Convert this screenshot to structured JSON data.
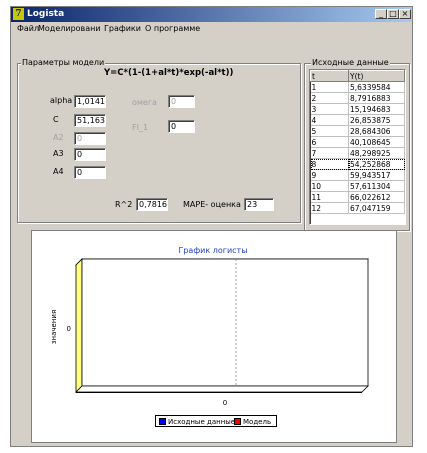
{
  "window": {
    "title": "Logista",
    "icon_letter": "7"
  },
  "title_buttons": {
    "minimize": "_",
    "maximize": "□",
    "close": "×"
  },
  "menu": {
    "items": [
      "Файл",
      "Моделировани",
      "Графики",
      "О программе"
    ]
  },
  "params": {
    "group_label": "Параметры модели",
    "formula": "Y=C*(1-(1+al*t)*exp(-al*t))",
    "alpha": {
      "label": "alpha",
      "value": "1,0141"
    },
    "c": {
      "label": "C",
      "value": "51,163"
    },
    "a2": {
      "label": "A2",
      "value": "0"
    },
    "a3": {
      "label": "A3",
      "value": "0"
    },
    "a4": {
      "label": "A4",
      "value": "0"
    },
    "omega": {
      "label": "омега",
      "value": "0"
    },
    "fi": {
      "label": "FI_1",
      "value": "0"
    },
    "r2": {
      "label": "R^2",
      "value": "0,7816"
    },
    "mape": {
      "label": "MAPE- оценка",
      "value": "23"
    }
  },
  "source_data": {
    "group_label": "Исходные данные",
    "columns": [
      "t",
      "Y(t)"
    ],
    "rows": [
      [
        "1",
        "5,6339584"
      ],
      [
        "2",
        "8,7916883"
      ],
      [
        "3",
        "15,194683"
      ],
      [
        "4",
        "26,853875"
      ],
      [
        "5",
        "28,684306"
      ],
      [
        "6",
        "40,108645"
      ],
      [
        "7",
        "48,298925"
      ],
      [
        "8",
        "54,252868"
      ],
      [
        "9",
        "59,943517"
      ],
      [
        "10",
        "57,611304"
      ],
      [
        "11",
        "66,022612"
      ],
      [
        "12",
        "67,047159"
      ]
    ]
  },
  "chart_data": {
    "type": "line",
    "title": "График логисты",
    "ylabel": "значения",
    "xlabel": "",
    "x_ticks": [
      "0"
    ],
    "y_ticks": [
      "0"
    ],
    "series": [
      {
        "name": "Исходные данные",
        "color": "#0000ff",
        "values": []
      },
      {
        "name": "Модель",
        "color": "#ff0000",
        "values": []
      }
    ],
    "legend": "bottom",
    "wall_color": "#ffff80"
  }
}
